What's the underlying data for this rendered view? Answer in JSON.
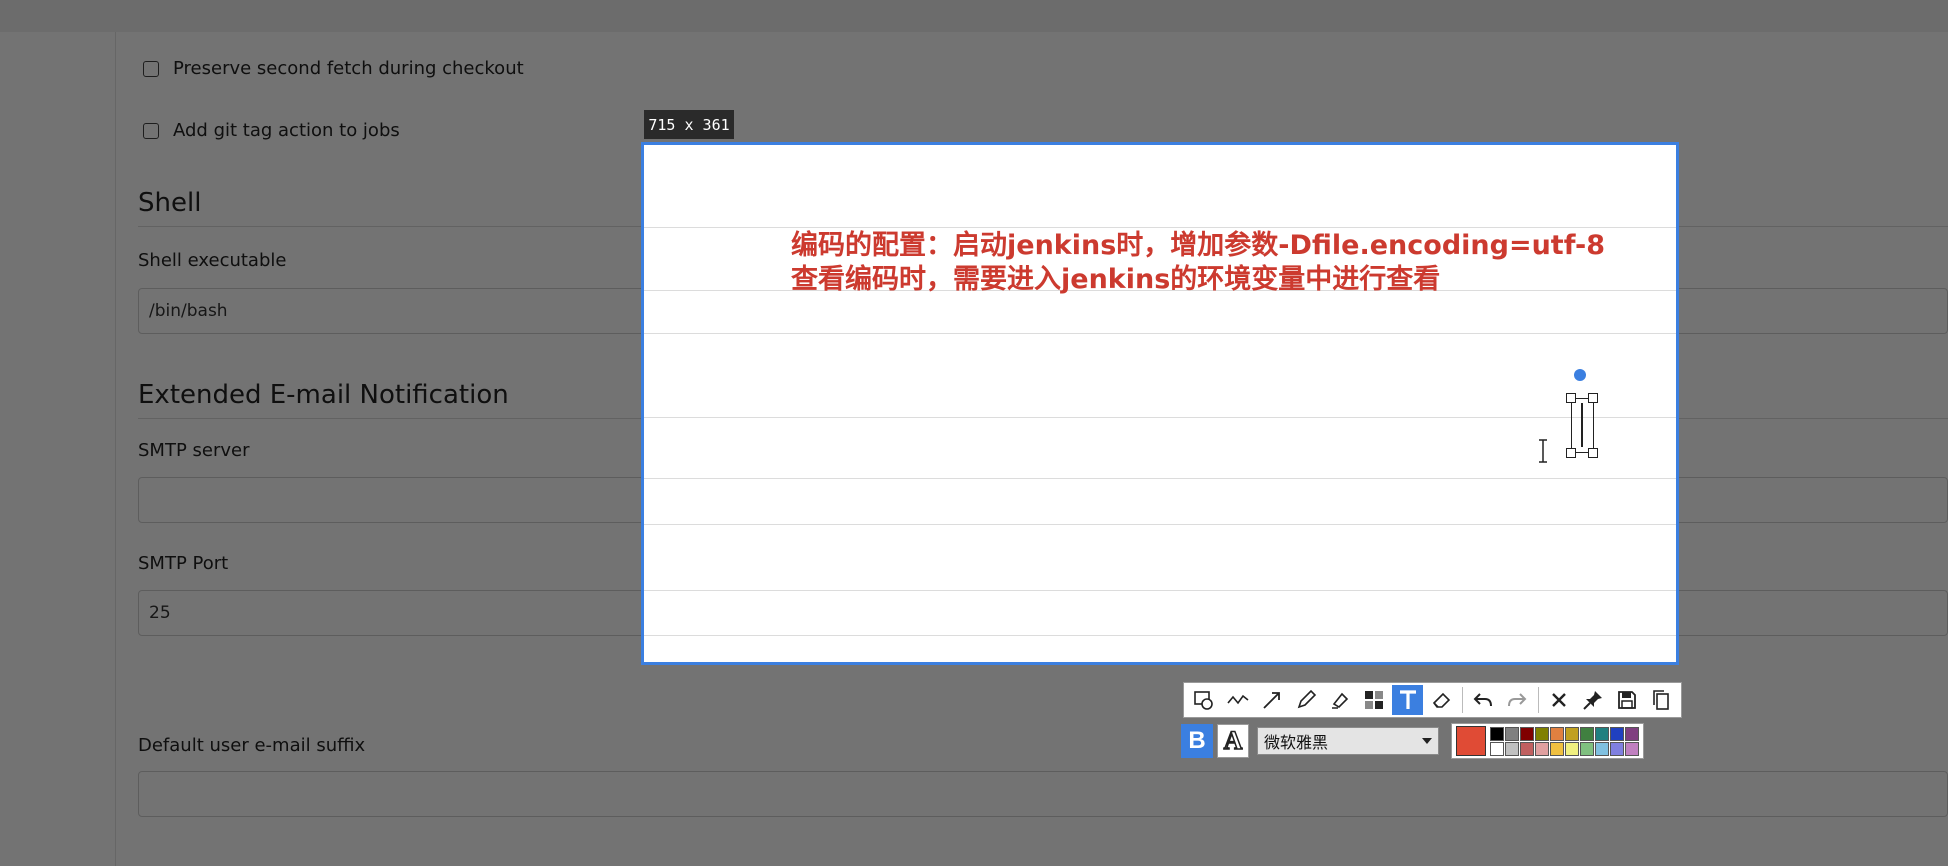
{
  "jenkins": {
    "checkbox_preserve": "Preserve second fetch during checkout",
    "checkbox_tag": "Add git tag action to jobs",
    "shell_title": "Shell",
    "shell_exec_label": "Shell executable",
    "shell_exec_value": "/bin/bash",
    "email_title": "Extended E-mail Notification",
    "smtp_server_label": "SMTP server",
    "smtp_server_value": "",
    "smtp_port_label": "SMTP Port",
    "smtp_port_value": "25",
    "default_suffix_label": "Default user e-mail suffix",
    "default_suffix_value": ""
  },
  "capture": {
    "size_label": "715 x 361",
    "annotation_line1": "编码的配置：启动jenkins时，增加参数-Dfile.encoding=utf-8",
    "annotation_line2": "查看编码时，需要进入jenkins的环境变量中进行查看",
    "annotation_color": "#cc3a2f",
    "border_color": "#3b7fe0"
  },
  "toolbar": {
    "tools": [
      "rectangle-icon",
      "polyline-icon",
      "arrow-icon",
      "pencil-icon",
      "marker-icon",
      "mosaic-icon",
      "text-tool-icon",
      "eraser-icon",
      "undo-icon",
      "redo-icon",
      "close-icon",
      "pin-icon",
      "save-icon",
      "copy-icon"
    ],
    "active_tool": "text-tool-icon",
    "font_name": "微软雅黑",
    "bold_label": "B",
    "outline_label": "A",
    "current_color": "#e04b35",
    "palette_top": [
      "#000000",
      "#808080",
      "#800000",
      "#808000",
      "#e08040",
      "#c0a020",
      "#408040",
      "#208080",
      "#2040c0",
      "#804080"
    ],
    "palette_bottom": [
      "#ffffff",
      "#c0c0c0",
      "#c06060",
      "#e0a0a0",
      "#f0c040",
      "#f0f080",
      "#80c080",
      "#80c0e0",
      "#8080e0",
      "#c080c0"
    ]
  }
}
